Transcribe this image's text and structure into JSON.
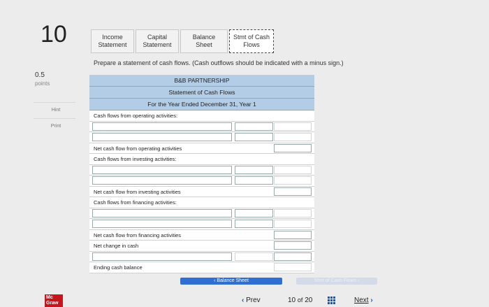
{
  "question": {
    "number": "10",
    "points_value": "0.5",
    "points_label": "points"
  },
  "sidebar": {
    "hint": "Hint",
    "print": "Print"
  },
  "tabs": [
    {
      "line1": "Income",
      "line2": "Statement"
    },
    {
      "line1": "Capital",
      "line2": "Statement"
    },
    {
      "line1": "Balance Sheet",
      "line2": ""
    },
    {
      "line1": "Stmt of Cash",
      "line2": "Flows"
    }
  ],
  "instructions": "Prepare a statement of cash flows. (Cash outflows should be indicated with a minus sign.)",
  "statement": {
    "company": "B&B PARTNERSHIP",
    "title": "Statement of Cash Flows",
    "period": "For the Year Ended December 31, Year 1",
    "labels": {
      "operating": "Cash flows from operating activities:",
      "net_operating": "Net cash flow from operating activities",
      "investing": "Cash flows from investing activities:",
      "net_investing": "Net cash flow from investing activities",
      "financing": "Cash flows from financing activities:",
      "net_financing": "Net cash flow from financing activities",
      "net_change": "Net change in cash",
      "ending": "Ending cash balance"
    }
  },
  "bottom_nav": {
    "prev_tab": "Balance Sheet",
    "next_tab": "Stmt of Cash Flows"
  },
  "pager": {
    "prev": "Prev",
    "current": "10",
    "of": "of",
    "total": "20",
    "next": "Next"
  },
  "logo": {
    "line1": "Mc",
    "line2": "Graw"
  }
}
